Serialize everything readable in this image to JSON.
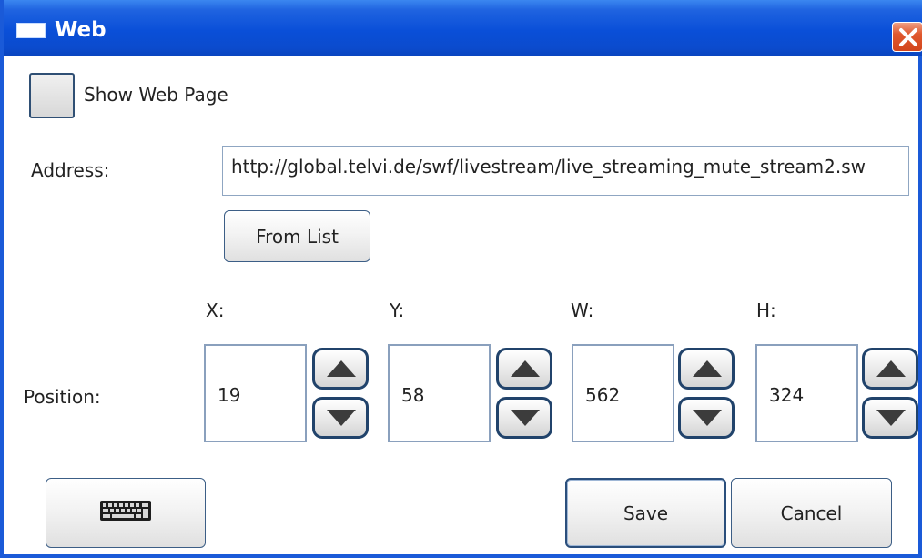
{
  "window": {
    "title": "Web"
  },
  "show_web_page": {
    "label": "Show Web Page",
    "checked": false
  },
  "address": {
    "label": "Address:",
    "value": "http://global.telvi.de/swf/livestream/live_streaming_mute_stream2.sw"
  },
  "from_list_button": "From List",
  "position": {
    "label": "Position:",
    "fields": [
      {
        "label": "X:",
        "value": "19"
      },
      {
        "label": "Y:",
        "value": "58"
      },
      {
        "label": "W:",
        "value": "562"
      },
      {
        "label": "H:",
        "value": "324"
      }
    ]
  },
  "footer": {
    "keyboard_icon": "keyboard-icon",
    "save": "Save",
    "cancel": "Cancel"
  },
  "colors": {
    "titlebar": "#0a4fd8",
    "close": "#d2461c",
    "border": "#21436b"
  }
}
